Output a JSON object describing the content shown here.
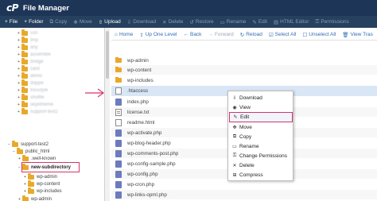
{
  "header": {
    "logo": "cP",
    "title": "File Manager"
  },
  "toolbar": {
    "items": [
      {
        "icon": "+",
        "label": "File",
        "enabled": true
      },
      {
        "icon": "+",
        "label": "Folder",
        "enabled": true
      },
      {
        "icon": "⧉",
        "label": "Copy",
        "enabled": false
      },
      {
        "icon": "✥",
        "label": "Move",
        "enabled": false
      },
      {
        "icon": "⇧",
        "label": "Upload",
        "enabled": true
      },
      {
        "icon": "⇩",
        "label": "Download",
        "enabled": false
      },
      {
        "icon": "✕",
        "label": "Delete",
        "enabled": false
      },
      {
        "icon": "↺",
        "label": "Restore",
        "enabled": false
      },
      {
        "icon": "▭",
        "label": "Rename",
        "enabled": false
      },
      {
        "icon": "✎",
        "label": "Edit",
        "enabled": false
      },
      {
        "icon": "▤",
        "label": "HTML Editor",
        "enabled": false
      },
      {
        "icon": "⚿",
        "label": "Permissions",
        "enabled": false
      }
    ]
  },
  "subbar": {
    "items": [
      {
        "icon": "⌂",
        "label": "Home"
      },
      {
        "icon": "⇧",
        "label": "Up One Level"
      },
      {
        "icon": "←",
        "label": "Back"
      },
      {
        "icon": "→",
        "label": "Forward"
      },
      {
        "icon": "↻",
        "label": "Reload"
      },
      {
        "icon": "☑",
        "label": "Select All"
      },
      {
        "icon": "☐",
        "label": "Unselect All"
      },
      {
        "icon": "🗑",
        "label": "View Tras"
      }
    ]
  },
  "tree": {
    "blurred": [
      "ssh",
      "tmp",
      "any",
      "assemble",
      "bridge",
      "card",
      "demo",
      "doppe",
      "fresstyle",
      "shuffle",
      "skyetheme",
      "support-test2"
    ],
    "items": [
      {
        "label": "support-test2",
        "level": 0,
        "toggle": "−"
      },
      {
        "label": "public_html",
        "level": 1,
        "toggle": "−"
      },
      {
        "label": ".well-known",
        "level": 2,
        "toggle": "+"
      },
      {
        "label": "new-subdirectory",
        "level": 2,
        "toggle": "−",
        "highlight": true
      },
      {
        "label": "wp-admin",
        "level": 3,
        "toggle": "+"
      },
      {
        "label": "wp-content",
        "level": 3,
        "toggle": "+"
      },
      {
        "label": "wp-includes",
        "level": 3,
        "toggle": "+"
      },
      {
        "label": "wp-admin",
        "level": 2,
        "toggle": "+"
      }
    ]
  },
  "files": [
    {
      "name": "wp-admin",
      "type": "folder"
    },
    {
      "name": "wp-content",
      "type": "folder"
    },
    {
      "name": "wp-includes",
      "type": "folder"
    },
    {
      "name": ".htaccess",
      "type": "doc",
      "selected": true
    },
    {
      "name": "index.php",
      "type": "php"
    },
    {
      "name": "license.txt",
      "type": "txt"
    },
    {
      "name": "readme.html",
      "type": "doc"
    },
    {
      "name": "wp-activate.php",
      "type": "php"
    },
    {
      "name": "wp-blog-header.php",
      "type": "php"
    },
    {
      "name": "wp-comments-post.php",
      "type": "php"
    },
    {
      "name": "wp-config-sample.php",
      "type": "php"
    },
    {
      "name": "wp-config.php",
      "type": "php"
    },
    {
      "name": "wp-cron.php",
      "type": "php"
    },
    {
      "name": "wp-links-opml.php",
      "type": "php"
    }
  ],
  "context_menu": {
    "items": [
      {
        "icon": "⇩",
        "label": "Download"
      },
      {
        "icon": "◉",
        "label": "View"
      },
      {
        "icon": "✎",
        "label": "Edit",
        "active": true
      },
      {
        "icon": "✥",
        "label": "Move"
      },
      {
        "icon": "⧉",
        "label": "Copy"
      },
      {
        "icon": "▭",
        "label": "Rename"
      },
      {
        "icon": "⚿",
        "label": "Change Permissions"
      },
      {
        "icon": "✕",
        "label": "Delete"
      },
      {
        "icon": "⊞",
        "label": "Compress"
      }
    ]
  },
  "colors": {
    "header": "#1d3557",
    "toolbar": "#26405f",
    "accent": "#2f6db5",
    "highlight": "#d6336c",
    "folder": "#e8a92a"
  }
}
